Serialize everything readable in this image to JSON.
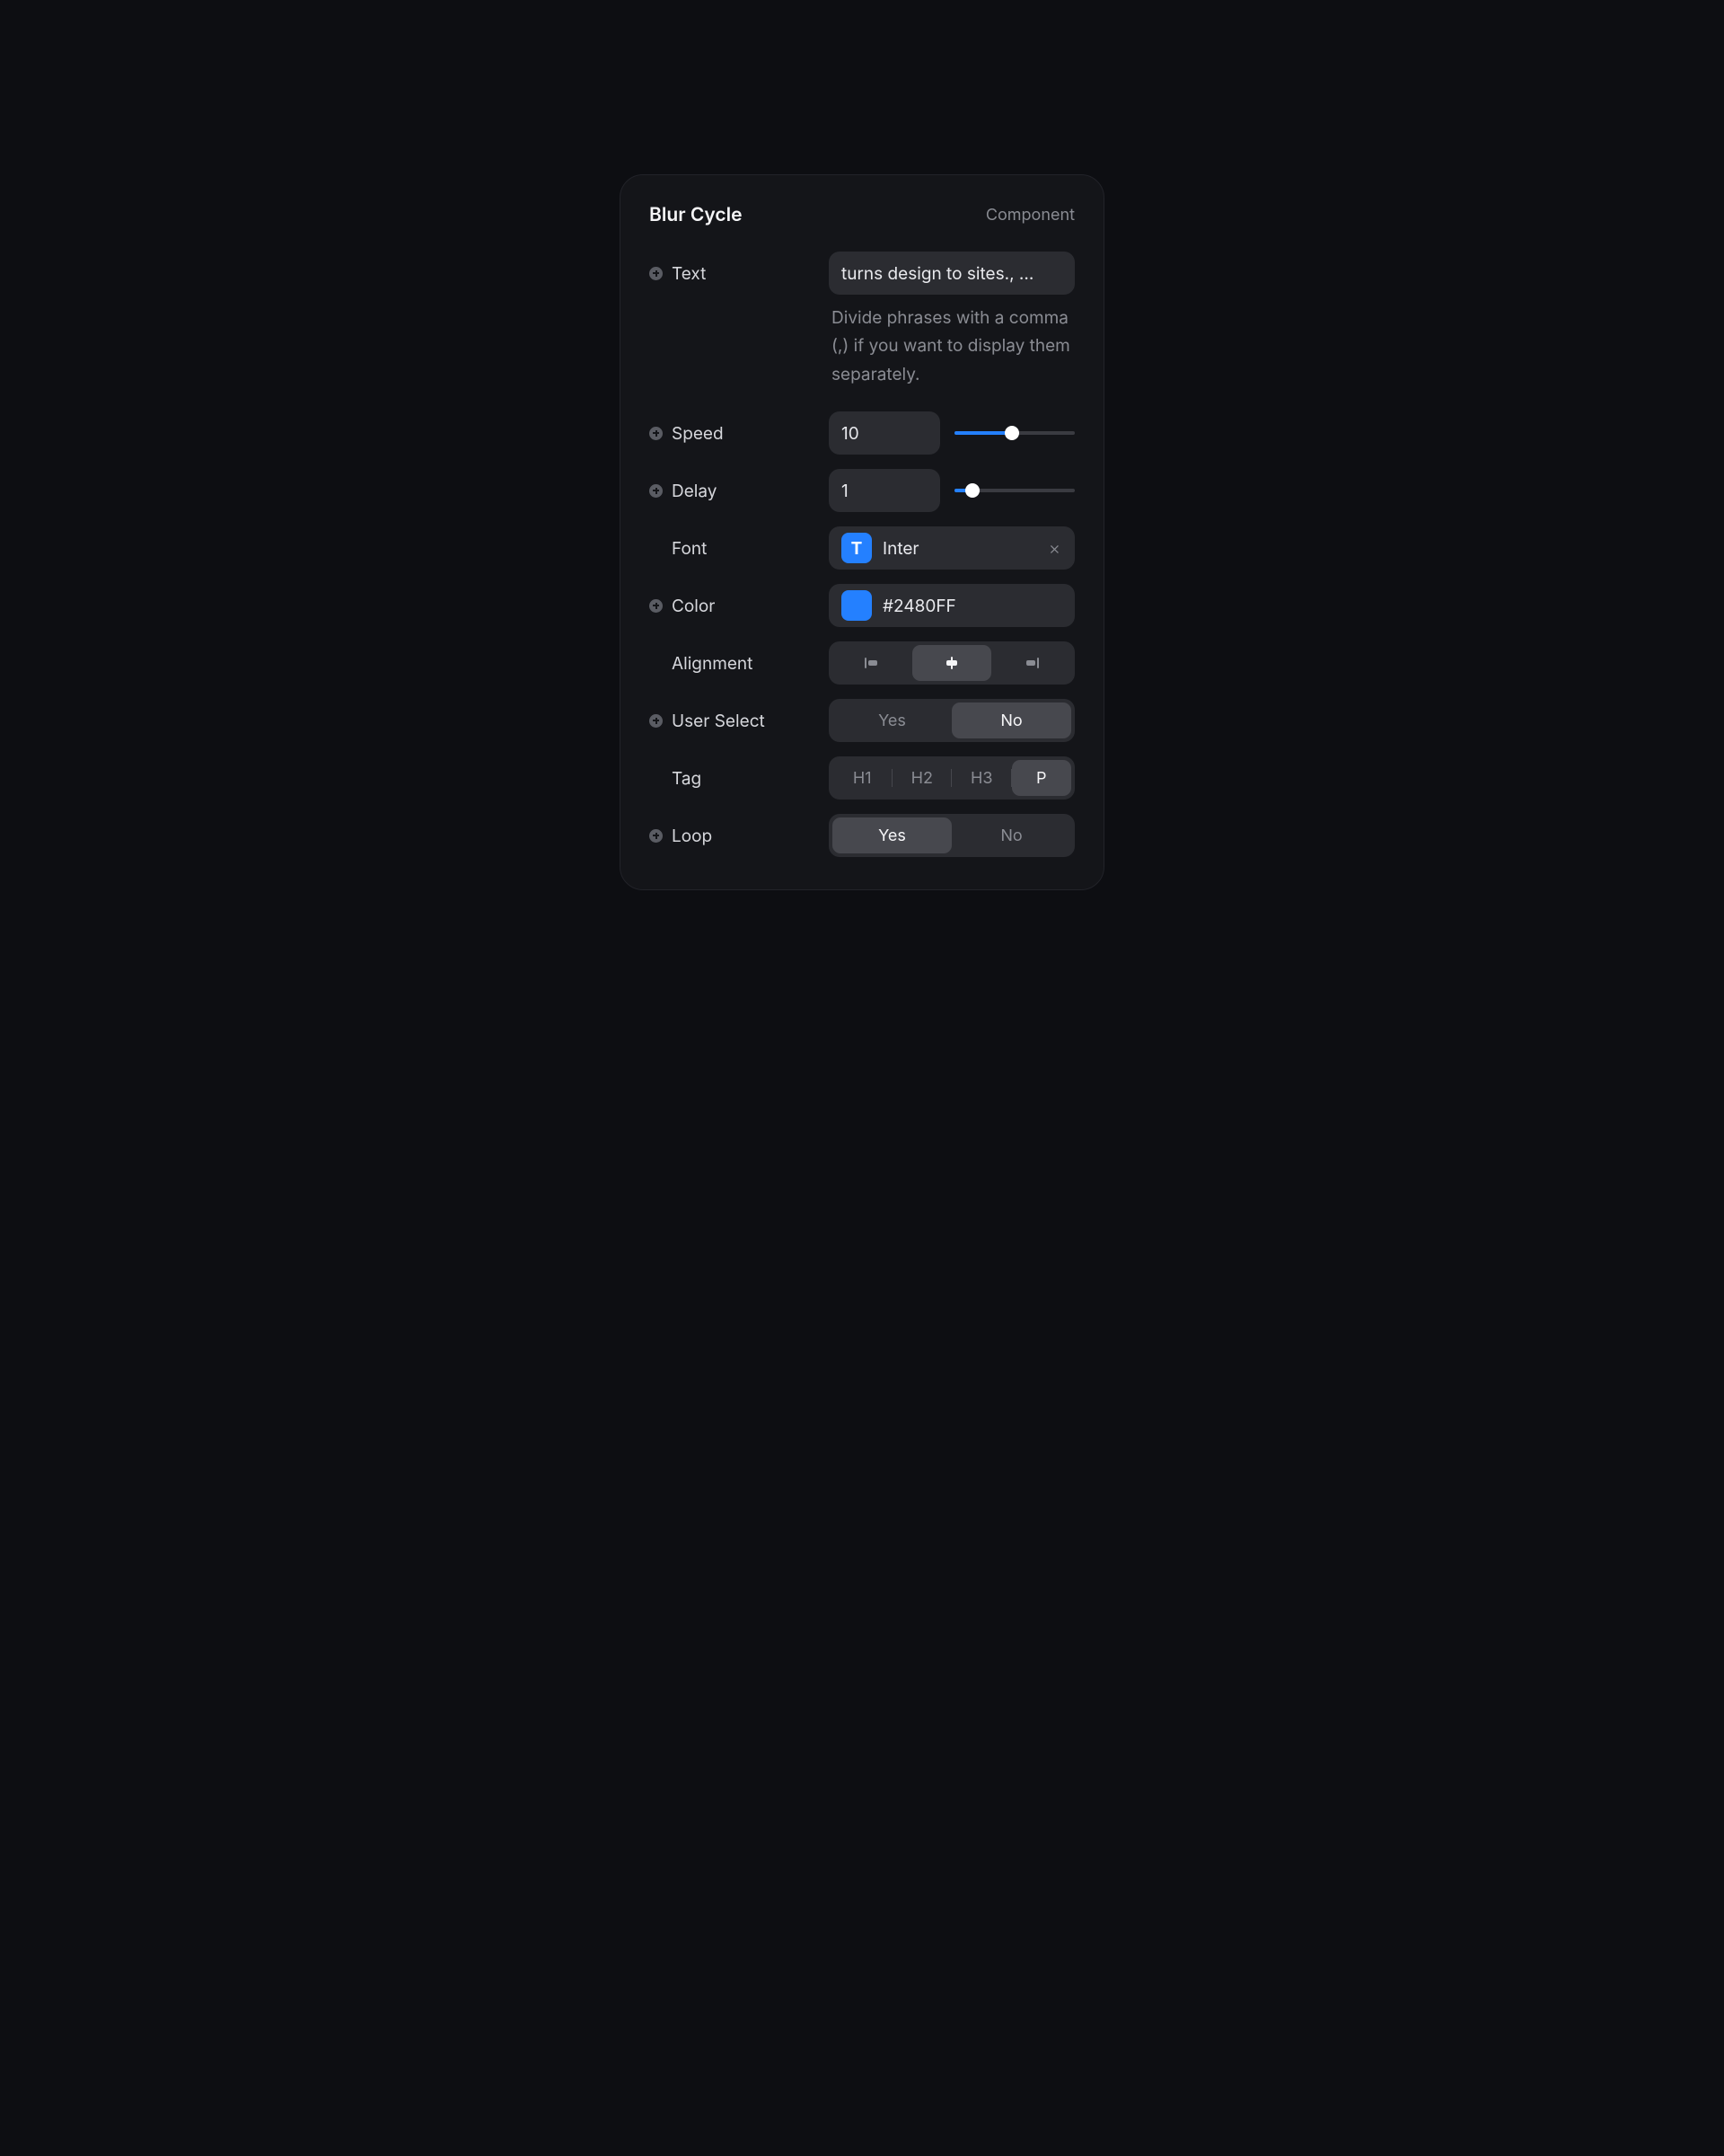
{
  "header": {
    "title": "Blur Cycle",
    "type": "Component"
  },
  "rows": {
    "text": {
      "label": "Text",
      "value": "turns design to sites., ...",
      "hint": "Divide phrases with a comma (,) if you want to display them separately."
    },
    "speed": {
      "label": "Speed",
      "value": "10",
      "slider_percent": 48
    },
    "delay": {
      "label": "Delay",
      "value": "1",
      "slider_percent": 15
    },
    "font": {
      "label": "Font",
      "chip_letter": "T",
      "value": "Inter"
    },
    "color": {
      "label": "Color",
      "value": "#2480FF",
      "swatch": "#2480FF"
    },
    "alignment": {
      "label": "Alignment",
      "options": [
        "left",
        "center",
        "right"
      ],
      "selected": "center"
    },
    "user_select": {
      "label": "User Select",
      "options": [
        "Yes",
        "No"
      ],
      "selected": "No"
    },
    "tag": {
      "label": "Tag",
      "options": [
        "H1",
        "H2",
        "H3",
        "P"
      ],
      "selected": "P"
    },
    "loop": {
      "label": "Loop",
      "options": [
        "Yes",
        "No"
      ],
      "selected": "Yes"
    }
  }
}
